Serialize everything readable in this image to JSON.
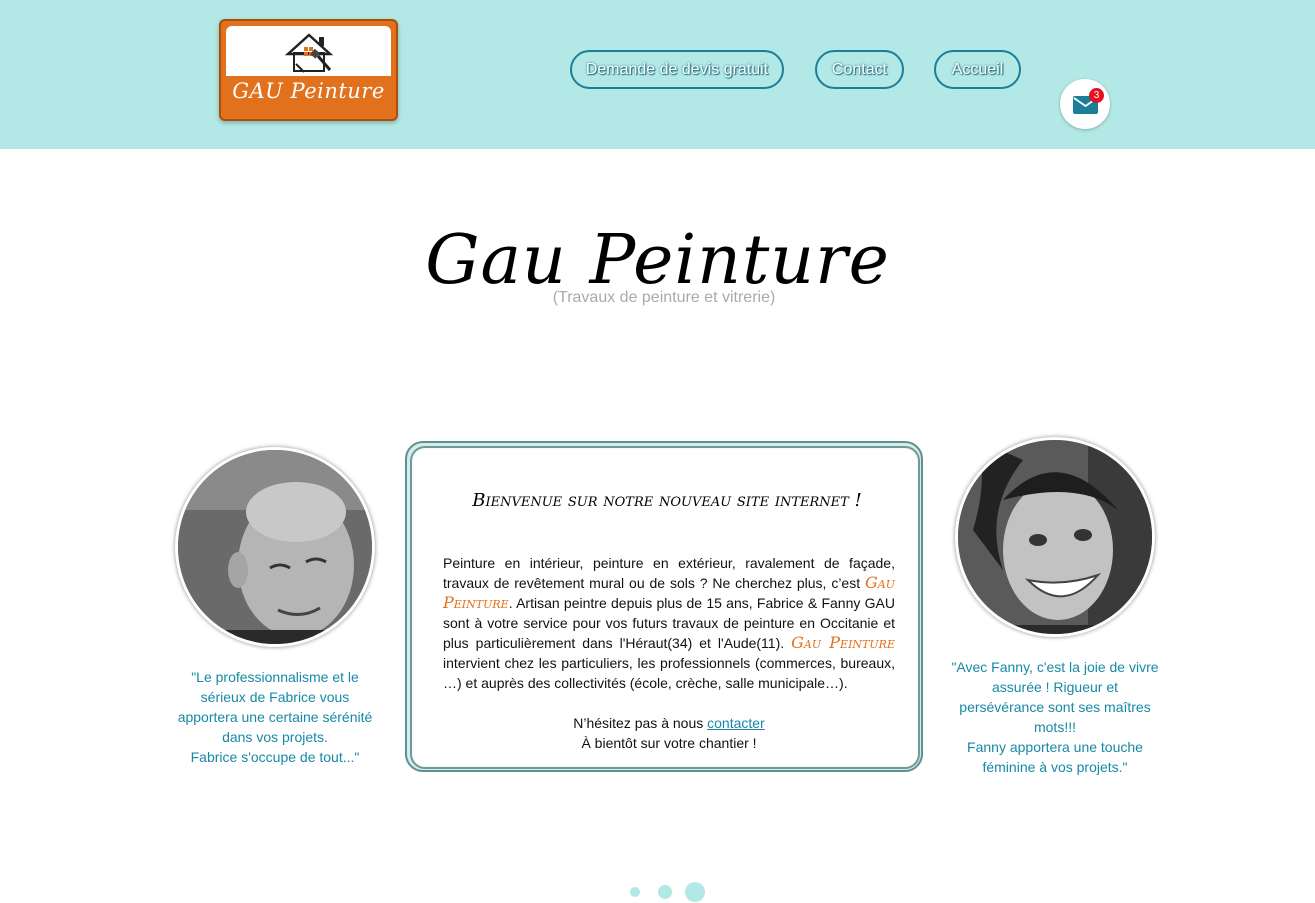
{
  "header": {
    "logo": {
      "text": "GAU Peinture",
      "icon": "house-paintbrush-icon"
    },
    "nav": [
      {
        "label": "Demande de devis gratuit"
      },
      {
        "label": "Contact"
      },
      {
        "label": "Accueil"
      }
    ],
    "mail": {
      "icon": "envelope-icon",
      "badge_count": "3"
    }
  },
  "hero": {
    "title": "Gau Peinture",
    "subtitle": "(Travaux de peinture et vitrerie)"
  },
  "left": {
    "avatar": "photo-fabrice",
    "quote": "\"Le professionnalisme et le sérieux de Fabrice vous apportera une certaine sérénité dans vos projets.\nFabrice s'occupe de tout...\""
  },
  "card": {
    "title": "Bienvenue sur notre nouveau site internet !",
    "body_1": "Peinture en intérieur, peinture en extérieur, ravalement de façade, travaux de revêtement mural ou de sols ? Ne cherchez plus, c’est ",
    "brand": "Gau Peinture",
    "body_2": ". Artisan peintre depuis plus de 15 ans, Fabrice & Fanny GAU sont à votre service pour vos futurs travaux de peinture en Occitanie et plus particulièrement dans l'Héraut(34) et l'Aude(11). ",
    "body_3": " intervient chez les particuliers, les professionnels (commerces, bureaux, …) et auprès des collectivités (école, crèche, salle municipale…).",
    "cta_prefix": "N’hésitez pas à nous ",
    "cta_link": "contacter",
    "cta_line2": "À bientôt sur votre chantier !"
  },
  "right": {
    "avatar": "photo-fanny",
    "quote": "\"Avec Fanny, c'est la joie de vivre assurée ! Rigueur et persévérance sont ses maîtres mots!!!\nFanny apportera une touche féminine à vos projets.\""
  },
  "carousel": {
    "active_index": 3,
    "count": 3
  },
  "colors": {
    "header_bg": "#b2e8e5",
    "nav_border": "#1b7f9a",
    "brand_orange": "#e2711d",
    "quote_text": "#1789a6",
    "badge": "#e2121f"
  }
}
